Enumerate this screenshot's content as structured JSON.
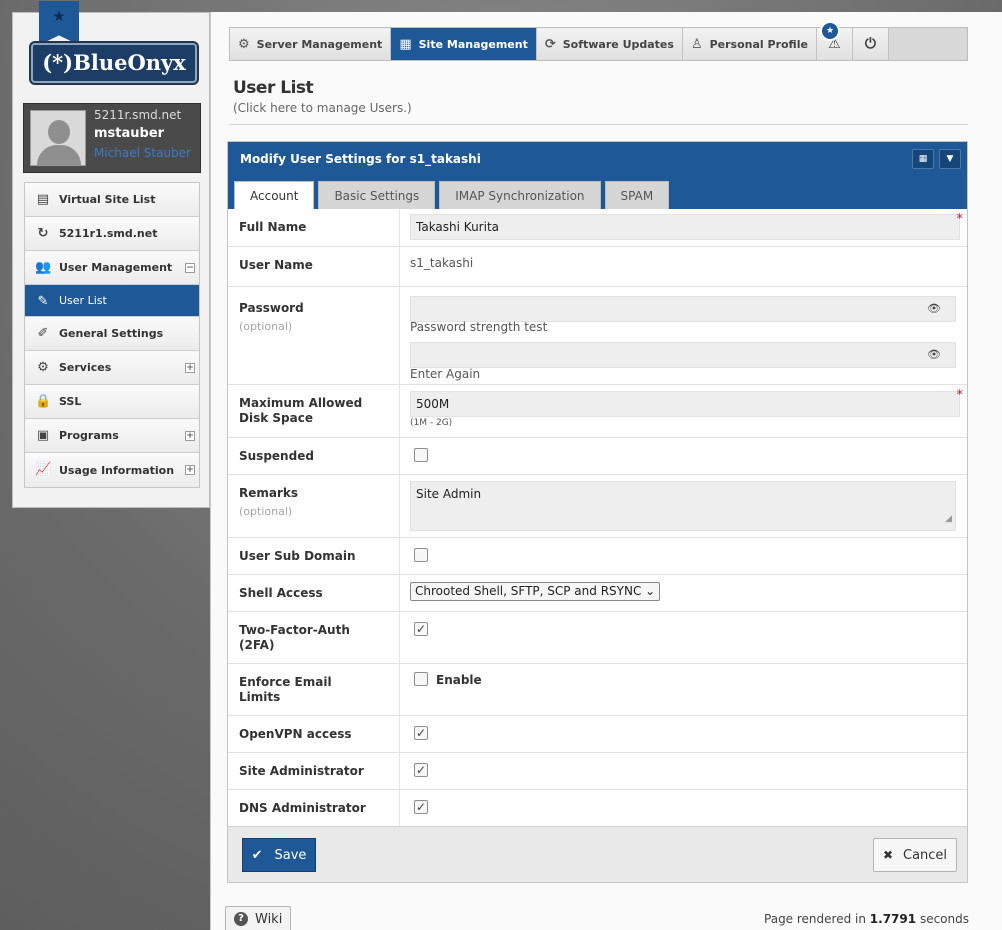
{
  "brand": {
    "logo_text": "(*)BlueOnyx",
    "ribbon_icon": "star-icon"
  },
  "user": {
    "host": "5211r.smd.net",
    "username": "mstauber",
    "full_name": "Michael Stauber"
  },
  "sidebar": {
    "items": [
      {
        "label": "Virtual Site List",
        "icon": "list-icon",
        "expander": ""
      },
      {
        "label": "5211r1.smd.net",
        "icon": "refresh-icon",
        "expander": ""
      },
      {
        "label": "User Management",
        "icon": "users-icon",
        "expander": "−"
      },
      {
        "label": "User List",
        "icon": "pencil-icon",
        "expander": ""
      },
      {
        "label": "General Settings",
        "icon": "edit-icon",
        "expander": ""
      },
      {
        "label": "Services",
        "icon": "gear-icon",
        "expander": "+"
      },
      {
        "label": "SSL",
        "icon": "lock-icon",
        "expander": ""
      },
      {
        "label": "Programs",
        "icon": "chip-icon",
        "expander": "+"
      },
      {
        "label": "Usage Information",
        "icon": "chart-icon",
        "expander": "+"
      }
    ]
  },
  "topnav": {
    "server_management": "Server Management",
    "site_management": "Site Management",
    "software_updates": "Software Updates",
    "personal_profile": "Personal Profile"
  },
  "page": {
    "title": "User List",
    "subtitle": "(Click here to manage Users.)"
  },
  "panel": {
    "title": "Modify User Settings for s1_takashi",
    "tabs": [
      "Account",
      "Basic Settings",
      "IMAP Synchronization",
      "SPAM"
    ],
    "active_tab": "Account"
  },
  "form": {
    "full_name": {
      "label": "Full Name",
      "value": "Takashi Kurita"
    },
    "user_name": {
      "label": "User Name",
      "value": "s1_takashi"
    },
    "password": {
      "label": "Password",
      "optional": "(optional)",
      "hint1": "Password strength test",
      "hint2": "Enter Again"
    },
    "disk_space": {
      "label_line1": "Maximum Allowed",
      "label_line2": "Disk Space",
      "value": "500M",
      "range": "(1M - 2G)"
    },
    "suspended": {
      "label": "Suspended",
      "checked": false
    },
    "remarks": {
      "label": "Remarks",
      "optional": "(optional)",
      "value": "Site Admin"
    },
    "sub_domain": {
      "label": "User Sub Domain",
      "checked": false
    },
    "shell_access": {
      "label": "Shell Access",
      "value": "Chrooted Shell, SFTP, SCP and RSYNC"
    },
    "two_factor": {
      "label_line1": "Two-Factor-Auth",
      "label_line2": "(2FA)",
      "checked": true
    },
    "email_limits": {
      "label_line1": "Enforce Email",
      "label_line2": "Limits",
      "checked": false,
      "option": "Enable"
    },
    "openvpn": {
      "label": "OpenVPN access",
      "checked": true
    },
    "site_admin": {
      "label": "Site Administrator",
      "checked": true
    },
    "dns_admin": {
      "label": "DNS Administrator",
      "checked": true
    }
  },
  "buttons": {
    "save": "Save",
    "cancel": "Cancel"
  },
  "footer": {
    "wiki": "Wiki",
    "render_prefix": "Page rendered in",
    "render_time": "1.7791",
    "render_suffix": "seconds"
  }
}
